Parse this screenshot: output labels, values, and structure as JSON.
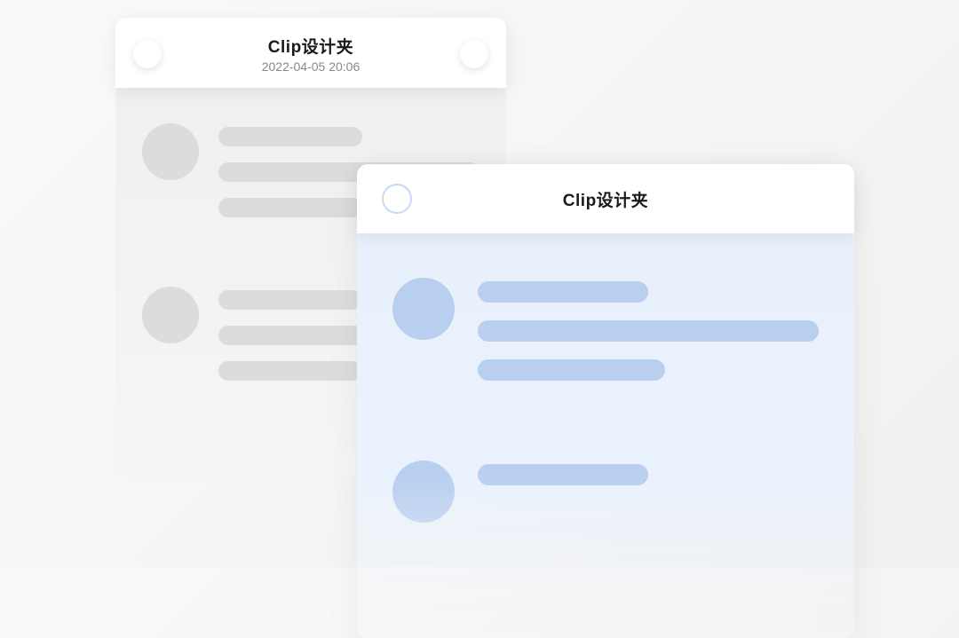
{
  "back_card": {
    "title": "Clip设计夹",
    "timestamp": "2022-04-05 20:06"
  },
  "front_card": {
    "title": "Clip设计夹"
  }
}
